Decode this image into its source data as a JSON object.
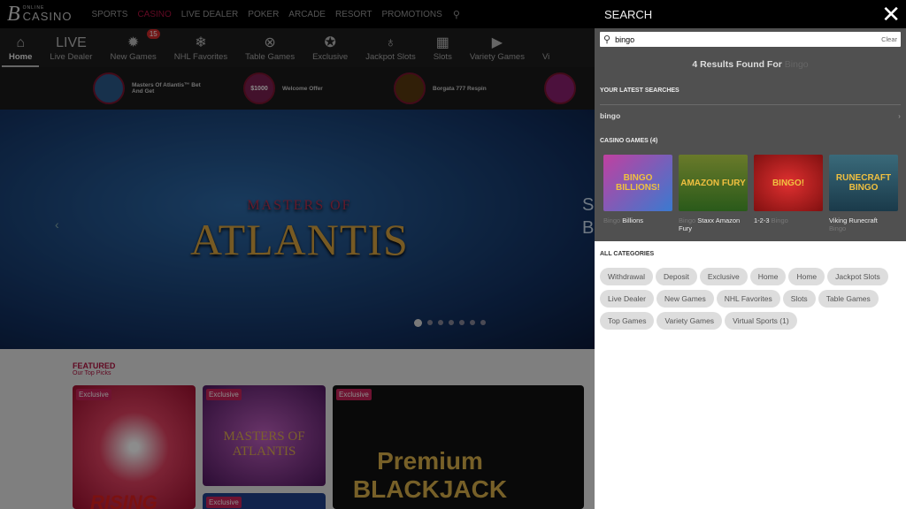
{
  "site": {
    "logo_letter": "B",
    "logo_top": "ONLINE",
    "logo_bottom": "CASINO"
  },
  "topnav": [
    "SPORTS",
    "CASINO",
    "LIVE DEALER",
    "POKER",
    "ARCADE",
    "RESORT",
    "PROMOTIONS"
  ],
  "topnav_active": "CASINO",
  "categories": [
    {
      "label": "Home",
      "icon": "home-icon"
    },
    {
      "label": "Live Dealer",
      "icon": "live-icon",
      "glyph": "LIVE"
    },
    {
      "label": "New Games",
      "icon": "new-icon",
      "badge": "15"
    },
    {
      "label": "NHL Favorites",
      "icon": "snowflake-icon"
    },
    {
      "label": "Table Games",
      "icon": "chip-icon"
    },
    {
      "label": "Exclusive",
      "icon": "star-icon"
    },
    {
      "label": "Jackpot Slots",
      "icon": "money-bag-icon"
    },
    {
      "label": "Slots",
      "icon": "slot-machine-icon"
    },
    {
      "label": "Variety Games",
      "icon": "play-icon"
    },
    {
      "label": "Vi",
      "icon": ""
    }
  ],
  "promos": [
    "Masters Of Atlantis™ Bet And Get",
    "Welcome Offer",
    "Borgata 777 Respin"
  ],
  "promo_image_text": "$1000",
  "hero": {
    "subtitle": "MASTERS OF",
    "title": "ATLANTIS",
    "slides": 7,
    "active_slide": 1,
    "edge_text": "S B"
  },
  "featured": {
    "title": "FEATURED",
    "subtitle": "Our Top Picks",
    "badge": "Exclusive",
    "tiles": [
      "RISING",
      "MASTERS OF ATLANTIS",
      "Premium BLACKJACK"
    ]
  },
  "search": {
    "title": "SEARCH",
    "query": "bingo",
    "clear": "Clear",
    "results_prefix": "4 Results Found For",
    "results_term": "Bingo",
    "latest_heading": "YOUR LATEST SEARCHES",
    "latest": [
      "bingo"
    ],
    "games_heading": "CASINO GAMES (4)",
    "games": [
      {
        "faded": "Bingo",
        "name": "Billions",
        "art": "BINGO BILLIONS!",
        "bg": "linear-gradient(135deg,#c040a0,#3a7ad0)"
      },
      {
        "faded": "Bingo",
        "name": "Staxx Amazon Fury",
        "art": "AMAZON FURY",
        "bg": "linear-gradient(#6a7a2a,#2a5a1a)"
      },
      {
        "faded": "Bingo",
        "name": "1-2-3",
        "name_after": true,
        "art": "BINGO!",
        "bg": "radial-gradient(#e03030,#801010)"
      },
      {
        "faded": "Bingo",
        "name": "Viking Runecraft",
        "faded_after": true,
        "art": "RUNECRAFT BINGO",
        "bg": "linear-gradient(#3a6a7a,#1a3a4a)"
      }
    ],
    "all_categories_heading": "ALL CATEGORIES",
    "all_categories": [
      "Withdrawal",
      "Deposit",
      "Exclusive",
      "Home",
      "Home",
      "Jackpot Slots",
      "Live Dealer",
      "New Games",
      "NHL Favorites",
      "Slots",
      "Table Games",
      "Top Games",
      "Variety Games",
      "Virtual Sports (1)"
    ]
  }
}
